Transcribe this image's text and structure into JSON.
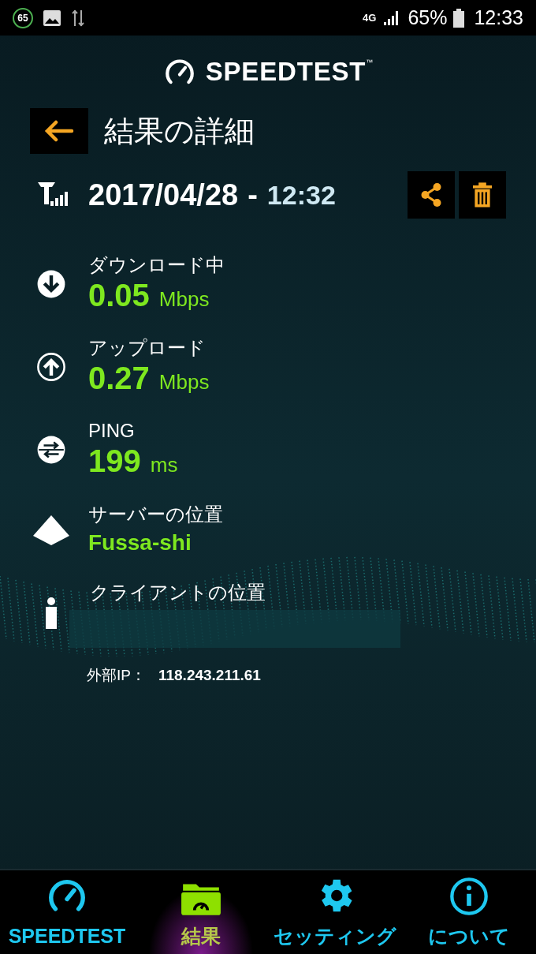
{
  "status_bar": {
    "notification_badge": "65",
    "network": "4G",
    "battery": "65%",
    "time": "12:33"
  },
  "header": {
    "logo": "SPEEDTEST",
    "trademark": "™"
  },
  "title": "結果の詳細",
  "result": {
    "date": "2017/04/28",
    "separator": "-",
    "time": "12:32"
  },
  "metrics": [
    {
      "kind": "download",
      "label": "ダウンロード中",
      "value": "0.05",
      "unit": "Mbps"
    },
    {
      "kind": "upload",
      "label": "アップロード",
      "value": "0.27",
      "unit": "Mbps"
    },
    {
      "kind": "ping",
      "label": "PING",
      "value": "199",
      "unit": "ms"
    }
  ],
  "server": {
    "label": "サーバーの位置",
    "value": "Fussa-shi"
  },
  "client": {
    "label": "クライアントの位置"
  },
  "external_ip": {
    "label": "外部IP：",
    "value": "118.243.211.61"
  },
  "tabs": [
    {
      "kind": "speedtest",
      "label": "SPEEDTEST",
      "selected": false
    },
    {
      "kind": "results",
      "label": "結果",
      "selected": true
    },
    {
      "kind": "settings",
      "label": "セッティング",
      "selected": false
    },
    {
      "kind": "about",
      "label": "について",
      "selected": false
    }
  ]
}
